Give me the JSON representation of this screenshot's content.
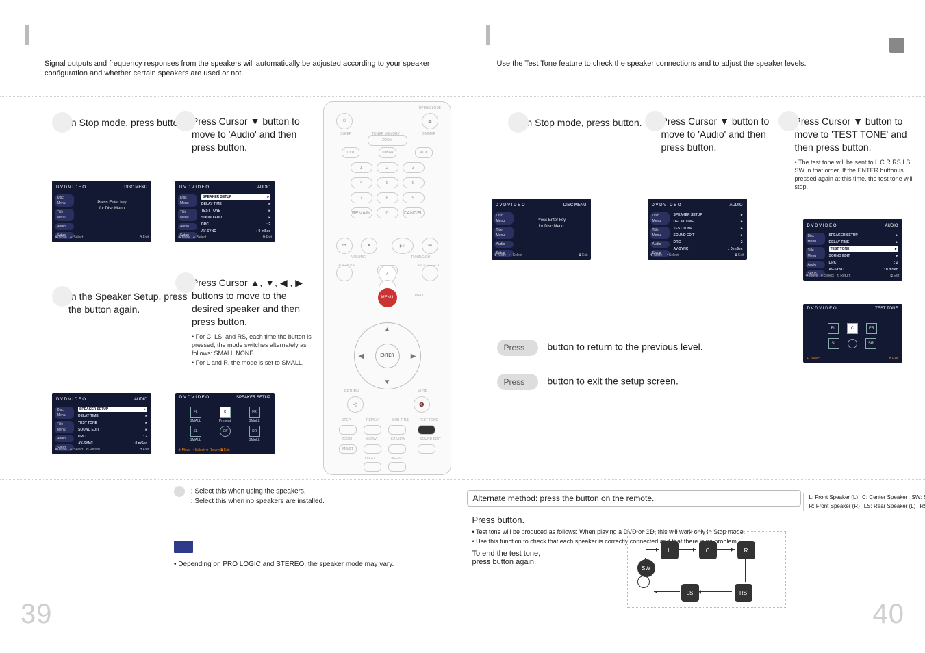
{
  "left_page_number": "39",
  "right_page_number": "40",
  "left_intro": "Signal outputs and frequency responses from the speakers will automatically be adjusted according to your speaker configuration and whether certain speakers are used or not.",
  "right_intro": "Use the Test Tone feature to check the speaker connections and to adjust the speaker levels.",
  "left": {
    "step1": "In Stop mode, press               button.",
    "step2": "Press Cursor ▼ button to move to 'Audio' and then press               button.",
    "step3": "In the Speaker Setup, press the               button again.",
    "step4_line1": "Press Cursor ▲, ▼, ◀ , ▶ buttons to move to the desired speaker and then press               button.",
    "step4_notes": [
      "For C, LS, and RS, each time the button is pressed, the mode switches alternately as follows: SMALL      NONE.",
      "For L and R, the mode is set to SMALL."
    ],
    "legend_small": ": Select this when using the speakers.",
    "legend_none": ": Select this when no speakers are installed.",
    "note": "• Depending on PRO LOGIC and STEREO, the speaker mode may vary."
  },
  "right": {
    "step1": "In Stop mode, press               button.",
    "step2": "Press Cursor ▼ button to move to 'Audio' and then press               button.",
    "step3": "Press Cursor ▼ button to move to 'TEST TONE' and then press               button.",
    "step3_notes": [
      "The test tone will be sent to L     C     R     RS     LS     SW in that order. If the ENTER button is pressed again at this time, the test tone will stop."
    ],
    "step4": "button to return to the previous level.",
    "step5": "button to exit the setup screen.",
    "altline": "Alternate method: press the                     button on the remote.",
    "alth": "Press                     button.",
    "altnotes": [
      "Test tone will be produced as follows: When playing a DVD or CD, this will work only in Stop mode.",
      "Use this function to check that each speaker is correctly connected and that there is no problem."
    ],
    "altend1": "To end the test tone,",
    "altend2": "press                     button again."
  },
  "speaker_legend": {
    "l": "L: Front Speaker (L)",
    "r": "R: Front Speaker (R)",
    "c": "C: Center Speaker",
    "ls": "LS: Rear Speaker (L)",
    "sw": "SW: Subwoofer",
    "rs": "RS: Rear Speaker (R)"
  },
  "menubox": {
    "hdr_left": "D V D V I D E O",
    "disc_menu": "DISC MENU",
    "audio": "AUDIO",
    "side": [
      "Disc Menu",
      "Title Menu",
      "Audio",
      "Setup"
    ],
    "press_enter": "Press Enter key\nfor Disc Menu",
    "list": [
      [
        "SPEAKER SETUP",
        "▸"
      ],
      [
        "DELAY TIME",
        "▸"
      ],
      [
        "TEST TONE",
        "▸"
      ],
      [
        "SOUND EDIT",
        "▸"
      ],
      [
        "DRC",
        ": 2"
      ],
      [
        "AV-SYNC",
        ": 0 mSec"
      ]
    ],
    "foot_move": "✥ Move",
    "foot_select": "↵ Select",
    "foot_return": "⟲ Return",
    "foot_exit": "⧉ Exit",
    "speaker_setup": "SPEAKER SETUP",
    "test_tone": "TEST TONE",
    "grid_labels": [
      "SMALL",
      "Present",
      "SMALL",
      "SMALL",
      "",
      "SMALL"
    ],
    "grid_nodes": [
      "FL",
      "C",
      "FR",
      "SL",
      "SW",
      "SR"
    ]
  },
  "remote": {
    "open_close": "OPEN/CLOSE",
    "ezview": "EZ VIEW",
    "sleep": "SLEEP",
    "tuner_memory": "TUNER MEMORY",
    "dimmer": "DIMMER",
    "zoom": "ZOOM",
    "dvd": "DVD",
    "tuner": "TUNER",
    "aux": "AUX",
    "remain": "REMAIN",
    "cancel": "CANCEL",
    "volume": "VOLUME",
    "tuning_ch": "TUNING/CH",
    "menu": "MENU",
    "info": "INFO",
    "enter": "ENTER",
    "return": "RETURN",
    "mute": "MUTE",
    "step": "STEP",
    "repeat": "REPEAT",
    "subtitle": "SUB TITLE",
    "test_tone": "TEST TONE",
    "slow": "SLOW",
    "sound_edit": "SOUND EDIT",
    "logo": "LOGO",
    "digest": "DIGEST",
    "mo_st": "MO/ST",
    "plii_mode": "PL II MODE",
    "plii_effect": "PL II EFFECT"
  },
  "press_badge": "Press",
  "spk_nodes": {
    "l": "L",
    "c": "C",
    "r": "R",
    "sw": "SW",
    "ls": "LS",
    "rs": "RS"
  }
}
